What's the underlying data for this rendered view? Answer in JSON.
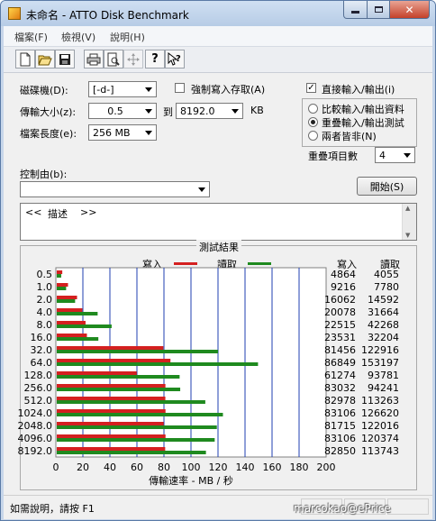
{
  "window": {
    "title": "未命名 - ATTO Disk Benchmark"
  },
  "menu": [
    "檔案(F)",
    "檢視(V)",
    "說明(H)"
  ],
  "toolbar": [
    "new-icon",
    "open-icon",
    "save-icon",
    "print-icon",
    "print-preview-icon",
    "move-icon",
    "help-icon",
    "context-help-icon"
  ],
  "form": {
    "drive_label": "磁碟機(D):",
    "drive_value": "[-d-]",
    "transfer_label": "傳輸大小(z):",
    "transfer_from": "0.5",
    "transfer_to_label": "到",
    "transfer_to": "8192.0",
    "transfer_unit": "KB",
    "length_label": "檔案長度(e):",
    "length_value": "256 MB",
    "force_write_label": "強制寫入存取(A)",
    "force_write_checked": false,
    "direct_io_label": "直接輸入/輸出(i)",
    "direct_io_checked": true,
    "radio_compare": "比較輸入/輸出資料",
    "radio_overlap": "重疊輸入/輸出測試",
    "radio_neither": "兩者皆非(N)",
    "radio_selected": "overlap",
    "queue_label": "重疊項目數",
    "queue_value": "4",
    "controlled_label": "控制由(b):",
    "controlled_value": "",
    "start_button": "開始(S)",
    "desc_left": "<<",
    "desc_text": "描述",
    "desc_right": ">>"
  },
  "results": {
    "title": "測試結果",
    "legend_write": "寫入",
    "legend_read": "讀取",
    "col_write": "寫入",
    "col_read": "讀取",
    "xlabel": "傳輸速率 - MB / 秒"
  },
  "status": {
    "text": "如需說明，請按 F1"
  },
  "watermark": "marcokao@ePrice",
  "colors": {
    "write": "#d42020",
    "read": "#1f8a1f"
  },
  "chart_data": {
    "type": "bar",
    "orientation": "horizontal",
    "categories": [
      "0.5",
      "1.0",
      "2.0",
      "4.0",
      "8.0",
      "16.0",
      "32.0",
      "64.0",
      "128.0",
      "256.0",
      "512.0",
      "1024.0",
      "2048.0",
      "4096.0",
      "8192.0"
    ],
    "series": [
      {
        "name": "寫入",
        "values": [
          4864,
          9216,
          16062,
          20078,
          22515,
          23531,
          81456,
          86849,
          61274,
          83032,
          82978,
          83106,
          81715,
          83106,
          82850
        ]
      },
      {
        "name": "讀取",
        "values": [
          4055,
          7780,
          14592,
          31664,
          42268,
          32204,
          122916,
          153197,
          93781,
          94241,
          113263,
          126620,
          122016,
          120374,
          113743
        ]
      }
    ],
    "value_units": "KB/s",
    "xlabel": "傳輸速率 - MB / 秒",
    "xticks": [
      0,
      20,
      40,
      60,
      80,
      100,
      120,
      140,
      160,
      180,
      200
    ],
    "xlim": [
      0,
      200
    ],
    "grid": true
  }
}
